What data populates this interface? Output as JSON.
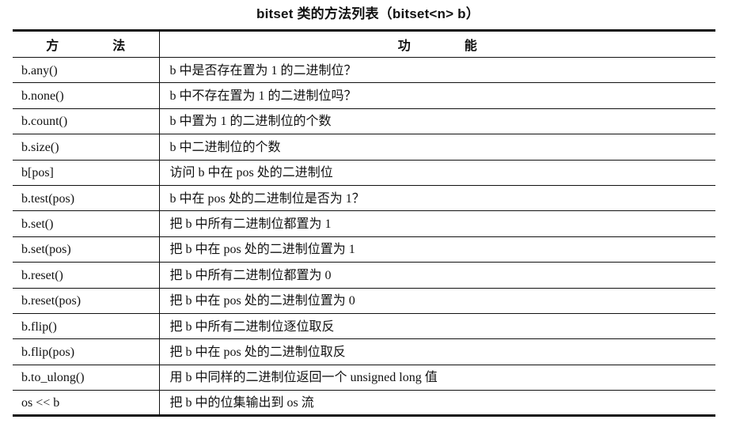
{
  "caption": "bitset 类的方法列表（bitset<n> b）",
  "table": {
    "headers": [
      "方　法",
      "功　能"
    ],
    "rows": [
      {
        "method": "b.any()",
        "description": "b 中是否存在置为 1 的二进制位？"
      },
      {
        "method": "b.none()",
        "description": "b 中不存在置为 1 的二进制位吗？"
      },
      {
        "method": "b.count()",
        "description": "b 中置为 1 的二进制位的个数"
      },
      {
        "method": "b.size()",
        "description": "b 中二进制位的个数"
      },
      {
        "method": "b[pos]",
        "description": "访问 b 中在 pos 处的二进制位"
      },
      {
        "method": "b.test(pos)",
        "description": "b 中在 pos 处的二进制位是否为 1？"
      },
      {
        "method": "b.set()",
        "description": "把 b 中所有二进制位都置为 1"
      },
      {
        "method": "b.set(pos)",
        "description": "把 b 中在 pos 处的二进制位置为 1"
      },
      {
        "method": "b.reset()",
        "description": "把 b 中所有二进制位都置为 0"
      },
      {
        "method": "b.reset(pos)",
        "description": "把 b 中在 pos 处的二进制位置为 0"
      },
      {
        "method": "b.flip()",
        "description": "把 b 中所有二进制位逐位取反"
      },
      {
        "method": "b.flip(pos)",
        "description": "把 b 中在 pos 处的二进制位取反"
      },
      {
        "method": "b.to_ulong()",
        "description": "用 b 中同样的二进制位返回一个 unsigned long 值"
      },
      {
        "method": "os << b",
        "description": "把 b 中的位集输出到 os 流"
      }
    ]
  }
}
